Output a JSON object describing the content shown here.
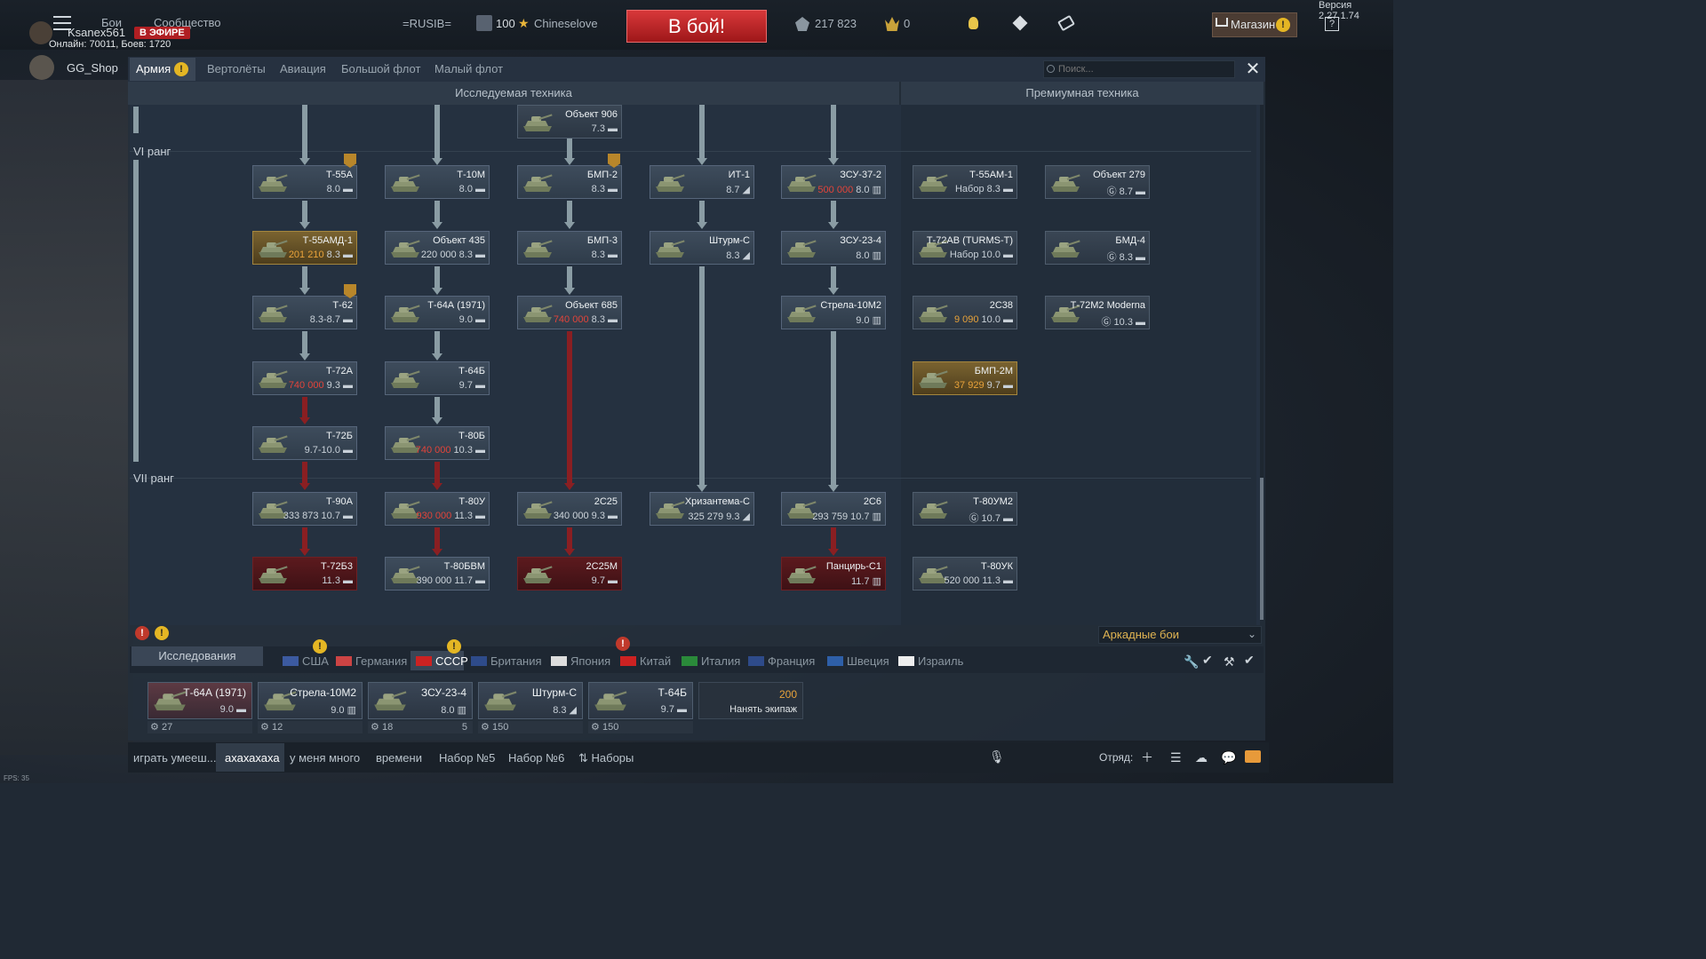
{
  "version": "Версия 2.27.1.74",
  "top": {
    "links": [
      "Бои",
      "Сообщество"
    ],
    "username": "Ksanex561",
    "live_badge": "В ЭФИРЕ",
    "online": "Онлайн: 70011, Боев: 1720",
    "squad_tag": "=RUSIB=",
    "rank": "100",
    "player2": "Chineselove",
    "battle_button": "В бой!",
    "silver_lions": "217 823",
    "golden_eagles": "0",
    "shop": "Магазин",
    "help": "?"
  },
  "gg_name": "GG_Shop",
  "tabs": [
    {
      "label": "Армия",
      "active": true
    },
    {
      "label": "Вертолёты"
    },
    {
      "label": "Авиация"
    },
    {
      "label": "Большой флот"
    },
    {
      "label": "Малый флот"
    }
  ],
  "search_placeholder": "Поиск...",
  "sections": {
    "researched": "Исследуемая техника",
    "premium": "Премиумная техника"
  },
  "ranks": [
    "VI ранг",
    "VII ранг"
  ],
  "vehicles": [
    {
      "id": "v906",
      "name": "Объект 906",
      "sub": "7.3 ▬"
    },
    {
      "id": "t55a",
      "name": "Т-55А",
      "sub": "8.0 ▬"
    },
    {
      "id": "t10m",
      "name": "Т-10М",
      "sub": "8.0 ▬"
    },
    {
      "id": "bmp2",
      "name": "БМП-2",
      "sub": "8.3 ▬"
    },
    {
      "id": "it1",
      "name": "ИТ-1",
      "sub": "8.7 ◢"
    },
    {
      "id": "zsu37",
      "name": "ЗСУ-37-2",
      "cost": "500 000",
      "sub": "8.0 ▥"
    },
    {
      "id": "t55amd",
      "name": "Т-55АМД-1",
      "cost": "201 210",
      "sub": "8.3 ▬"
    },
    {
      "id": "o435",
      "name": "Объект 435",
      "cost": "220 000",
      "sub": "8.3 ▬"
    },
    {
      "id": "bmp3",
      "name": "БМП-3",
      "sub": "8.3 ▬"
    },
    {
      "id": "shturm",
      "name": "Штурм-С",
      "sub": "8.3 ◢"
    },
    {
      "id": "zsu234",
      "name": "ЗСУ-23-4",
      "sub": "8.0 ▥"
    },
    {
      "id": "t62",
      "name": "Т-62",
      "sub": "8.3-8.7 ▬"
    },
    {
      "id": "t64a",
      "name": "Т-64А (1971)",
      "sub": "9.0 ▬"
    },
    {
      "id": "o685",
      "name": "Объект 685",
      "cost": "740 000",
      "sub": "8.3 ▬"
    },
    {
      "id": "strela",
      "name": "Стрела-10М2",
      "sub": "9.0 ▥"
    },
    {
      "id": "t72a",
      "name": "Т-72А",
      "cost": "740 000",
      "sub": "9.3 ▬"
    },
    {
      "id": "t64b",
      "name": "Т-64Б",
      "sub": "9.7 ▬"
    },
    {
      "id": "t72b",
      "name": "Т-72Б",
      "sub": "9.7-10.0 ▬"
    },
    {
      "id": "t80b",
      "name": "Т-80Б",
      "cost": "740 000",
      "sub": "10.3 ▬"
    },
    {
      "id": "t90a",
      "name": "Т-90А",
      "cost": "333 873",
      "sub": "10.7 ▬"
    },
    {
      "id": "t80u",
      "name": "Т-80У",
      "cost": "930 000",
      "sub": "11.3 ▬"
    },
    {
      "id": "2s25",
      "name": "2С25",
      "cost": "340 000",
      "sub": "9.3 ▬"
    },
    {
      "id": "hriz",
      "name": "Хризантема-С",
      "cost": "325 279",
      "sub": "9.3 ◢"
    },
    {
      "id": "2s6",
      "name": "2С6",
      "cost": "293 759",
      "sub": "10.7 ▥"
    },
    {
      "id": "t72b3",
      "name": "Т-72Б3",
      "sub": "11.3 ▬"
    },
    {
      "id": "t80bvm",
      "name": "Т-80БВМ",
      "cost": "390 000",
      "sub": "11.7 ▬"
    },
    {
      "id": "2s25m",
      "name": "2С25М",
      "sub": "9.7 ▬"
    },
    {
      "id": "pantsir",
      "name": "Панцирь-С1",
      "sub": "11.7 ▥"
    },
    {
      "id": "t55am1",
      "name": "Т-55АМ-1",
      "sub": "Набор 8.3 ▬"
    },
    {
      "id": "o279",
      "name": "Объект 279",
      "sub": "Ⓖ 8.7 ▬"
    },
    {
      "id": "t72av",
      "name": "Т-72АВ (TURMS-T)",
      "sub": "Набор 10.0 ▬"
    },
    {
      "id": "bmd4",
      "name": "БМД-4",
      "sub": "Ⓖ 8.3 ▬"
    },
    {
      "id": "2s38",
      "name": "2С38",
      "cost": "9 090",
      "sub": "10.0 ▬"
    },
    {
      "id": "t72m2",
      "name": "Т-72М2 Moderna",
      "sub": "Ⓖ 10.3 ▬"
    },
    {
      "id": "bmp2m",
      "name": "БМП-2М",
      "cost": "37 929",
      "sub": "9.7 ▬"
    },
    {
      "id": "t80um2",
      "name": "Т-80УМ2",
      "sub": "Ⓖ 10.7 ▬"
    },
    {
      "id": "t80uk",
      "name": "Т-80УК",
      "cost": "520 000",
      "sub": "11.3 ▬"
    }
  ],
  "research_button": "Исследования",
  "nations": [
    "США",
    "Германия",
    "СССР",
    "Британия",
    "Япония",
    "Китай",
    "Италия",
    "Франция",
    "Швеция",
    "Израиль"
  ],
  "mode": "Аркадные бои",
  "slots": [
    {
      "name": "Т-64А (1971)",
      "sub": "9.0 ▬",
      "foot": "27"
    },
    {
      "name": "Стрела-10М2",
      "sub": "9.0 ▥",
      "foot": "12"
    },
    {
      "name": "ЗСУ-23-4",
      "sub": "8.0 ▥",
      "foot": "18",
      "foot2": "5"
    },
    {
      "name": "Штурм-С",
      "sub": "8.3 ◢",
      "foot": "150"
    },
    {
      "name": "Т-64Б",
      "sub": "9.7 ▬",
      "foot": "150"
    }
  ],
  "crew": {
    "cost": "200",
    "label": "Нанять экипаж"
  },
  "presets": [
    "играть умееш...",
    "ахахахаха",
    "у меня много",
    "времени",
    "Набор №5",
    "Набор №6",
    "Наборы"
  ],
  "squad_label": "Отряд:",
  "fps": "FPS: 35"
}
